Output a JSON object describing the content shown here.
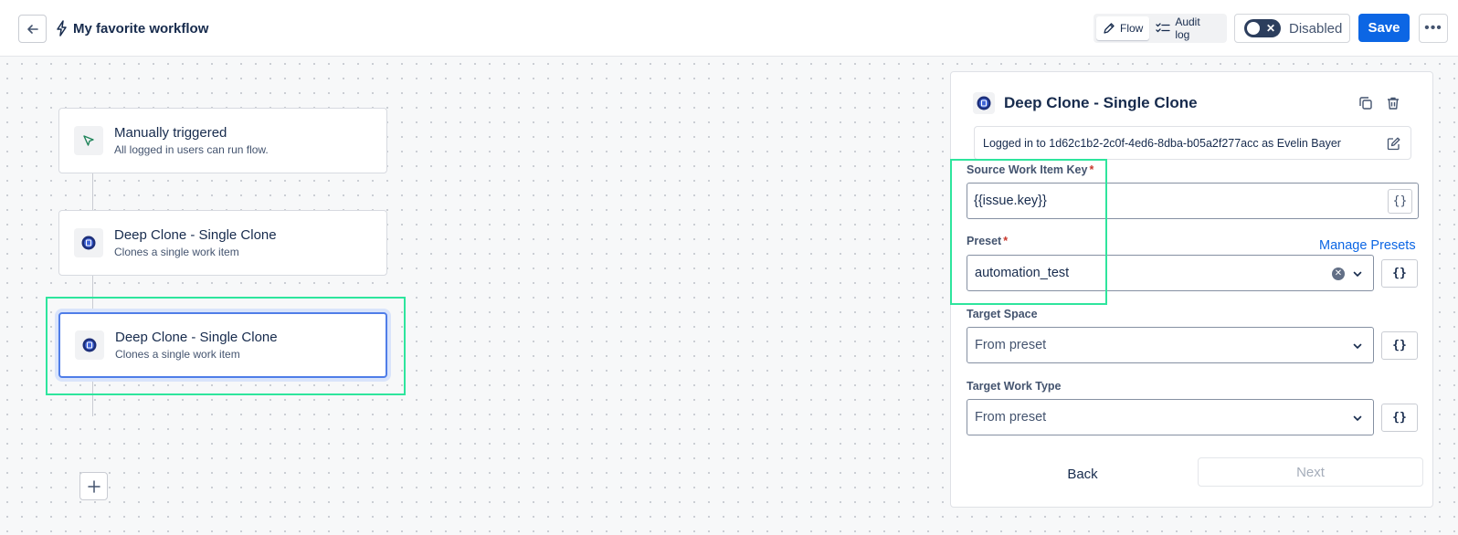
{
  "header": {
    "title": "My favorite workflow",
    "tabs": [
      {
        "label": "Flow",
        "active": true
      },
      {
        "label": "Audit log",
        "active": false
      }
    ],
    "toggle_label": "Disabled",
    "save_label": "Save"
  },
  "flow": {
    "nodes": [
      {
        "title": "Manually triggered",
        "subtitle": "All logged in users can run flow."
      },
      {
        "title": "Deep Clone - Single Clone",
        "subtitle": "Clones a single work item"
      },
      {
        "title": "Deep Clone - Single Clone",
        "subtitle": "Clones a single work item",
        "selected": true
      }
    ]
  },
  "panel": {
    "title": "Deep Clone - Single Clone",
    "login_text": "Logged in to 1d62c1b2-2c0f-4ed6-8dba-b05a2f277acc as Evelin Bayer",
    "source_key": {
      "label": "Source Work Item Key",
      "required": "*",
      "value": "{{issue.key}}"
    },
    "preset": {
      "label": "Preset",
      "required": "*",
      "value": "automation_test",
      "manage_link": "Manage Presets"
    },
    "target_space": {
      "label": "Target Space",
      "value": "From preset"
    },
    "target_work_type": {
      "label": "Target Work Type",
      "value": "From preset"
    },
    "braces": "{}",
    "back_label": "Back",
    "next_label": "Next"
  },
  "colors": {
    "accent": "#0c66e4",
    "highlight": "#2ee59d",
    "required": "#c9372c"
  }
}
